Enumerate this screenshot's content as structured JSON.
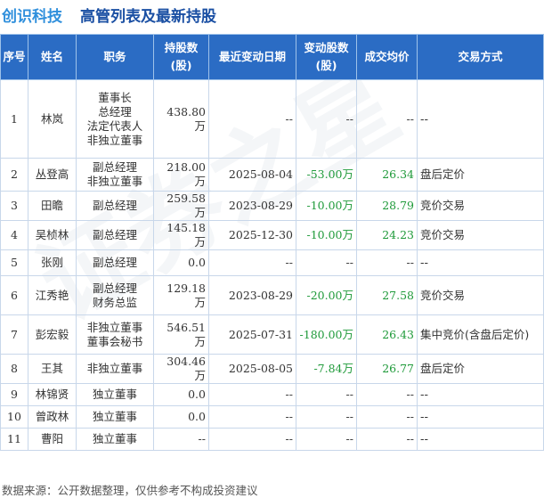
{
  "header": {
    "company": "创识科技",
    "title": "高管列表及最新持股"
  },
  "columns": {
    "seq": "序号",
    "name": "姓名",
    "role": "职务",
    "shares": "持股数(股)",
    "change_date": "最近变动日期",
    "change_shares": "变动股数(股)",
    "avg_price": "成交均价",
    "method": "交易方式"
  },
  "rows": [
    {
      "seq": "1",
      "name": "林岚",
      "roles": [
        "董事长",
        "总经理",
        "法定代表人",
        "非独立董事"
      ],
      "shares": "438.80万",
      "change_date": "--",
      "change_shares": "--",
      "avg_price": "--",
      "method": "--"
    },
    {
      "seq": "2",
      "name": "丛登高",
      "roles": [
        "副总经理",
        "非独立董事"
      ],
      "shares": "218.00万",
      "change_date": "2025-08-04",
      "change_shares": "-53.00万",
      "avg_price": "26.34",
      "method": "盘后定价"
    },
    {
      "seq": "3",
      "name": "田瞻",
      "roles": [
        "副总经理"
      ],
      "shares": "259.58万",
      "change_date": "2023-08-29",
      "change_shares": "-10.00万",
      "avg_price": "28.79",
      "method": "竞价交易"
    },
    {
      "seq": "4",
      "name": "吴桢林",
      "roles": [
        "副总经理"
      ],
      "shares": "145.18万",
      "change_date": "2025-12-30",
      "change_shares": "-10.00万",
      "avg_price": "24.23",
      "method": "竞价交易"
    },
    {
      "seq": "5",
      "name": "张刚",
      "roles": [
        "副总经理"
      ],
      "shares": "0.0",
      "change_date": "--",
      "change_shares": "--",
      "avg_price": "--",
      "method": "--"
    },
    {
      "seq": "6",
      "name": "江秀艳",
      "roles": [
        "副总经理",
        "财务总监"
      ],
      "shares": "129.18万",
      "change_date": "2023-08-29",
      "change_shares": "-20.00万",
      "avg_price": "27.58",
      "method": "竞价交易"
    },
    {
      "seq": "7",
      "name": "彭宏毅",
      "roles": [
        "非独立董事",
        "董事会秘书"
      ],
      "shares": "546.51万",
      "change_date": "2025-07-31",
      "change_shares": "-180.00万",
      "avg_price": "26.43",
      "method": "集中竞价(含盘后定价)"
    },
    {
      "seq": "8",
      "name": "王其",
      "roles": [
        "非独立董事"
      ],
      "shares": "304.46万",
      "change_date": "2025-08-05",
      "change_shares": "-7.84万",
      "avg_price": "26.77",
      "method": "盘后定价"
    },
    {
      "seq": "9",
      "name": "林锦贤",
      "roles": [
        "独立董事"
      ],
      "shares": "0.0",
      "change_date": "--",
      "change_shares": "--",
      "avg_price": "--",
      "method": "--"
    },
    {
      "seq": "10",
      "name": "曾政林",
      "roles": [
        "独立董事"
      ],
      "shares": "0.0",
      "change_date": "--",
      "change_shares": "--",
      "avg_price": "--",
      "method": "--"
    },
    {
      "seq": "11",
      "name": "曹阳",
      "roles": [
        "独立董事"
      ],
      "shares": "--",
      "change_date": "--",
      "change_shares": "--",
      "avg_price": "--",
      "method": "--"
    }
  ],
  "footer": "数据来源：公开数据整理，仅供参考不构成投资建议",
  "watermark": "证券之星",
  "colors": {
    "header_bg": "#2b6cc4",
    "company_title": "#2f8fdc",
    "main_title": "#1a4fa3",
    "change_value": "#1f9a3a",
    "price_value": "#1f9a3a"
  }
}
